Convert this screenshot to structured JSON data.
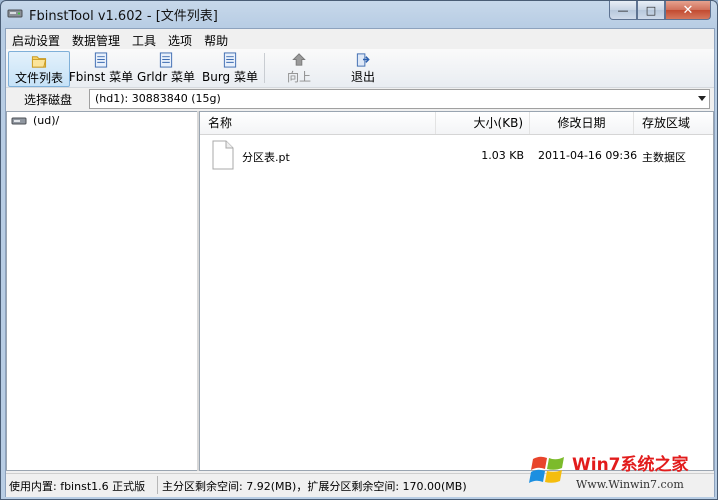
{
  "window": {
    "title": "FbinstTool v1.602 - [文件列表]"
  },
  "menu": [
    "启动设置",
    "数据管理",
    "工具",
    "选项",
    "帮助"
  ],
  "toolbar": [
    {
      "label": "文件列表",
      "icon": "folder-icon",
      "active": true
    },
    {
      "label": "Fbinst 菜单",
      "icon": "document-icon"
    },
    {
      "label": "Grldr 菜单",
      "icon": "document-icon"
    },
    {
      "label": "Burg 菜单",
      "icon": "document-icon"
    },
    {
      "label": "向上",
      "icon": "up-arrow-icon",
      "disabled": true
    },
    {
      "label": "退出",
      "icon": "exit-icon"
    }
  ],
  "disk": {
    "label": "选择磁盘",
    "selected": "(hd1): 30883840 (15g)"
  },
  "tree": {
    "root": "(ud)/"
  },
  "list": {
    "columns": [
      "名称",
      "大小(KB)",
      "修改日期",
      "存放区域"
    ],
    "rows": [
      {
        "name": "分区表.pt",
        "size": "1.03 KB",
        "date": "2011-04-16 09:36",
        "area": "主数据区"
      }
    ]
  },
  "status": {
    "core": "使用内置: fbinst1.6 正式版",
    "space": "主分区剩余空间: 7.92(MB)，扩展分区剩余空间: 170.00(MB)"
  },
  "watermark": {
    "title": "Win7系统之家",
    "url": "Www.Winwin7.com"
  },
  "colors": {
    "title_bar": "#b8cde4",
    "accent": "#7fb0d8",
    "close_button": "#c24a30"
  }
}
